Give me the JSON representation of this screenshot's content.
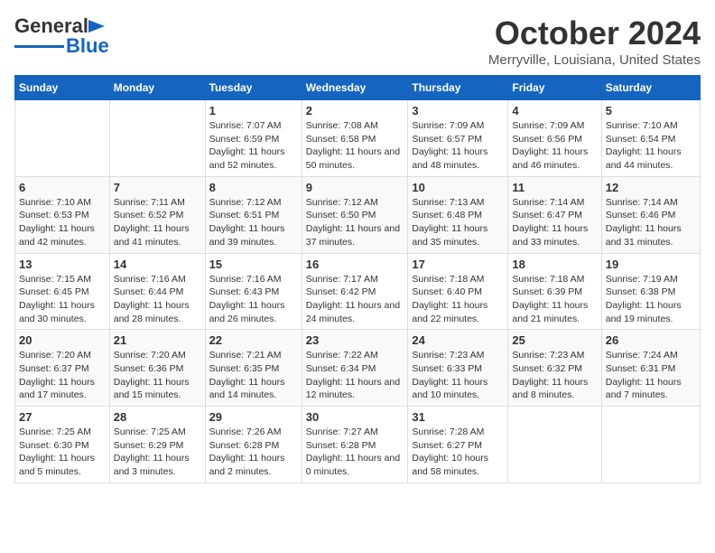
{
  "logo": {
    "general": "General",
    "blue": "Blue"
  },
  "title": "October 2024",
  "location": "Merryville, Louisiana, United States",
  "headers": [
    "Sunday",
    "Monday",
    "Tuesday",
    "Wednesday",
    "Thursday",
    "Friday",
    "Saturday"
  ],
  "weeks": [
    [
      {
        "day": "",
        "sunrise": "",
        "sunset": "",
        "daylight": ""
      },
      {
        "day": "",
        "sunrise": "",
        "sunset": "",
        "daylight": ""
      },
      {
        "day": "1",
        "sunrise": "Sunrise: 7:07 AM",
        "sunset": "Sunset: 6:59 PM",
        "daylight": "Daylight: 11 hours and 52 minutes."
      },
      {
        "day": "2",
        "sunrise": "Sunrise: 7:08 AM",
        "sunset": "Sunset: 6:58 PM",
        "daylight": "Daylight: 11 hours and 50 minutes."
      },
      {
        "day": "3",
        "sunrise": "Sunrise: 7:09 AM",
        "sunset": "Sunset: 6:57 PM",
        "daylight": "Daylight: 11 hours and 48 minutes."
      },
      {
        "day": "4",
        "sunrise": "Sunrise: 7:09 AM",
        "sunset": "Sunset: 6:56 PM",
        "daylight": "Daylight: 11 hours and 46 minutes."
      },
      {
        "day": "5",
        "sunrise": "Sunrise: 7:10 AM",
        "sunset": "Sunset: 6:54 PM",
        "daylight": "Daylight: 11 hours and 44 minutes."
      }
    ],
    [
      {
        "day": "6",
        "sunrise": "Sunrise: 7:10 AM",
        "sunset": "Sunset: 6:53 PM",
        "daylight": "Daylight: 11 hours and 42 minutes."
      },
      {
        "day": "7",
        "sunrise": "Sunrise: 7:11 AM",
        "sunset": "Sunset: 6:52 PM",
        "daylight": "Daylight: 11 hours and 41 minutes."
      },
      {
        "day": "8",
        "sunrise": "Sunrise: 7:12 AM",
        "sunset": "Sunset: 6:51 PM",
        "daylight": "Daylight: 11 hours and 39 minutes."
      },
      {
        "day": "9",
        "sunrise": "Sunrise: 7:12 AM",
        "sunset": "Sunset: 6:50 PM",
        "daylight": "Daylight: 11 hours and 37 minutes."
      },
      {
        "day": "10",
        "sunrise": "Sunrise: 7:13 AM",
        "sunset": "Sunset: 6:48 PM",
        "daylight": "Daylight: 11 hours and 35 minutes."
      },
      {
        "day": "11",
        "sunrise": "Sunrise: 7:14 AM",
        "sunset": "Sunset: 6:47 PM",
        "daylight": "Daylight: 11 hours and 33 minutes."
      },
      {
        "day": "12",
        "sunrise": "Sunrise: 7:14 AM",
        "sunset": "Sunset: 6:46 PM",
        "daylight": "Daylight: 11 hours and 31 minutes."
      }
    ],
    [
      {
        "day": "13",
        "sunrise": "Sunrise: 7:15 AM",
        "sunset": "Sunset: 6:45 PM",
        "daylight": "Daylight: 11 hours and 30 minutes."
      },
      {
        "day": "14",
        "sunrise": "Sunrise: 7:16 AM",
        "sunset": "Sunset: 6:44 PM",
        "daylight": "Daylight: 11 hours and 28 minutes."
      },
      {
        "day": "15",
        "sunrise": "Sunrise: 7:16 AM",
        "sunset": "Sunset: 6:43 PM",
        "daylight": "Daylight: 11 hours and 26 minutes."
      },
      {
        "day": "16",
        "sunrise": "Sunrise: 7:17 AM",
        "sunset": "Sunset: 6:42 PM",
        "daylight": "Daylight: 11 hours and 24 minutes."
      },
      {
        "day": "17",
        "sunrise": "Sunrise: 7:18 AM",
        "sunset": "Sunset: 6:40 PM",
        "daylight": "Daylight: 11 hours and 22 minutes."
      },
      {
        "day": "18",
        "sunrise": "Sunrise: 7:18 AM",
        "sunset": "Sunset: 6:39 PM",
        "daylight": "Daylight: 11 hours and 21 minutes."
      },
      {
        "day": "19",
        "sunrise": "Sunrise: 7:19 AM",
        "sunset": "Sunset: 6:38 PM",
        "daylight": "Daylight: 11 hours and 19 minutes."
      }
    ],
    [
      {
        "day": "20",
        "sunrise": "Sunrise: 7:20 AM",
        "sunset": "Sunset: 6:37 PM",
        "daylight": "Daylight: 11 hours and 17 minutes."
      },
      {
        "day": "21",
        "sunrise": "Sunrise: 7:20 AM",
        "sunset": "Sunset: 6:36 PM",
        "daylight": "Daylight: 11 hours and 15 minutes."
      },
      {
        "day": "22",
        "sunrise": "Sunrise: 7:21 AM",
        "sunset": "Sunset: 6:35 PM",
        "daylight": "Daylight: 11 hours and 14 minutes."
      },
      {
        "day": "23",
        "sunrise": "Sunrise: 7:22 AM",
        "sunset": "Sunset: 6:34 PM",
        "daylight": "Daylight: 11 hours and 12 minutes."
      },
      {
        "day": "24",
        "sunrise": "Sunrise: 7:23 AM",
        "sunset": "Sunset: 6:33 PM",
        "daylight": "Daylight: 11 hours and 10 minutes."
      },
      {
        "day": "25",
        "sunrise": "Sunrise: 7:23 AM",
        "sunset": "Sunset: 6:32 PM",
        "daylight": "Daylight: 11 hours and 8 minutes."
      },
      {
        "day": "26",
        "sunrise": "Sunrise: 7:24 AM",
        "sunset": "Sunset: 6:31 PM",
        "daylight": "Daylight: 11 hours and 7 minutes."
      }
    ],
    [
      {
        "day": "27",
        "sunrise": "Sunrise: 7:25 AM",
        "sunset": "Sunset: 6:30 PM",
        "daylight": "Daylight: 11 hours and 5 minutes."
      },
      {
        "day": "28",
        "sunrise": "Sunrise: 7:25 AM",
        "sunset": "Sunset: 6:29 PM",
        "daylight": "Daylight: 11 hours and 3 minutes."
      },
      {
        "day": "29",
        "sunrise": "Sunrise: 7:26 AM",
        "sunset": "Sunset: 6:28 PM",
        "daylight": "Daylight: 11 hours and 2 minutes."
      },
      {
        "day": "30",
        "sunrise": "Sunrise: 7:27 AM",
        "sunset": "Sunset: 6:28 PM",
        "daylight": "Daylight: 11 hours and 0 minutes."
      },
      {
        "day": "31",
        "sunrise": "Sunrise: 7:28 AM",
        "sunset": "Sunset: 6:27 PM",
        "daylight": "Daylight: 10 hours and 58 minutes."
      },
      {
        "day": "",
        "sunrise": "",
        "sunset": "",
        "daylight": ""
      },
      {
        "day": "",
        "sunrise": "",
        "sunset": "",
        "daylight": ""
      }
    ]
  ]
}
